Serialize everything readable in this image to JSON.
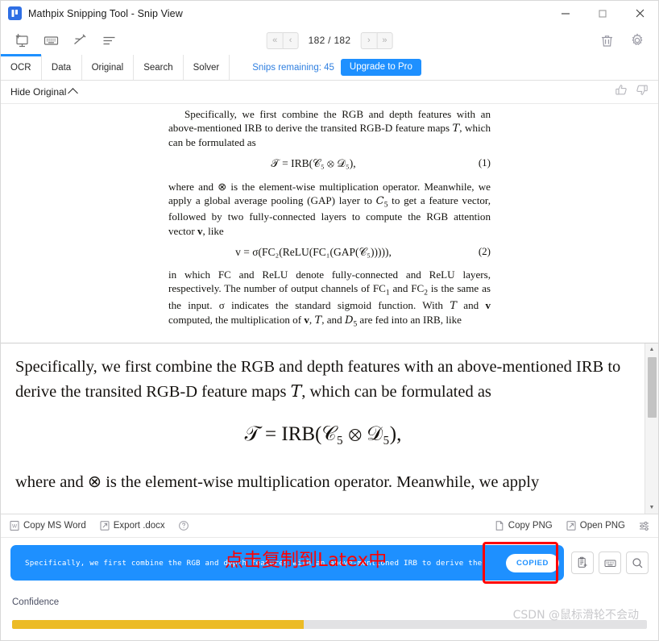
{
  "window": {
    "title": "Mathpix Snipping Tool - Snip View",
    "logo_glyph": "☰",
    "logo_color": "#2f6fe4",
    "controls": [
      {
        "name": "minimize-button",
        "glyph": "—"
      },
      {
        "name": "maximize-button",
        "glyph": "□"
      },
      {
        "name": "close-button",
        "glyph": "✕"
      }
    ]
  },
  "toolbar": {
    "icons": [
      {
        "name": "new-snip-icon",
        "label": "New Snip"
      },
      {
        "name": "keyboard-icon",
        "label": "Keyboard Shortcuts"
      },
      {
        "name": "draw-icon",
        "label": "Draw"
      },
      {
        "name": "list-icon",
        "label": "History"
      }
    ],
    "pager": {
      "first_label": "«",
      "prev_label": "‹",
      "count": "182 / 182",
      "next_label": "›",
      "last_label": "»"
    },
    "right_icons": [
      {
        "name": "trash-icon",
        "label": "Delete"
      },
      {
        "name": "gear-icon",
        "label": "Settings"
      }
    ]
  },
  "tabs": {
    "items": [
      {
        "label": "OCR",
        "active": true
      },
      {
        "label": "Data",
        "active": false
      },
      {
        "label": "Original",
        "active": false
      },
      {
        "label": "Search",
        "active": false
      },
      {
        "label": "Solver",
        "active": false
      }
    ],
    "snips_remaining": "Snips remaining: 45",
    "upgrade_label": "Upgrade to Pro",
    "accent_color": "#1e90ff"
  },
  "original_panel": {
    "hide_label": "Hide Original",
    "chevron": "chevron-up-icon",
    "thumbs_up": "thumbs-up-icon",
    "thumbs_down": "thumbs-down-icon",
    "paragraphs": [
      "Specifically, we first combine the RGB and depth features with an above-mentioned IRB to derive the transited RGB-D feature maps ᵀ, which can be formulated as",
      "where and ⊗ is the element-wise multiplication operator. Meanwhile, we apply a global average pooling (GAP) layer to 𝒞5 to get a feature vector, followed by two fully-connected layers to compute the RGB attention vector v, like",
      "in which FC and ReLU denote fully-connected and ReLU layers, respectively. The number of output channels of FC1 and FC2 is the same as the input. σ indicates the standard sigmoid function. With 𝒯 and v computed, the multiplication of v, 𝒯, and 𝒟5 are fed into an IRB, like"
    ],
    "equations": [
      {
        "body": "𝒯 = IRB(𝒞₅ ⊗ 𝒟₅),",
        "number": "(1)"
      },
      {
        "body": "v = σ(FC₂(ReLU(FC₁(GAP(𝒞₅))))),",
        "number": "(2)"
      }
    ]
  },
  "render_panel": {
    "paragraph": "Specifically, we first combine the RGB and depth features with an above-mentioned IRB to derive the transited RGB-D feature maps 𝒯, which can be formulated as",
    "equation": "𝒯 = IRB(𝒞₅ ⊗ 𝒟₅),",
    "partial_line": "where and ⊗ is the element-wise multiplication operator. Meanwhile, we apply",
    "scrollbar": {
      "up_arrow": "scroll-up-arrow-icon",
      "down_arrow": "scroll-down-arrow-icon"
    }
  },
  "action_bar": {
    "left": [
      {
        "name": "copy-ms-word-button",
        "label": "Copy MS Word",
        "icon": "word-icon"
      },
      {
        "name": "export-docx-button",
        "label": "Export .docx",
        "icon": "export-icon"
      },
      {
        "name": "help-button",
        "label": "",
        "icon": "help-icon"
      }
    ],
    "right": [
      {
        "name": "copy-png-button",
        "label": "Copy PNG",
        "icon": "file-icon"
      },
      {
        "name": "open-png-button",
        "label": "Open PNG",
        "icon": "external-link-icon"
      },
      {
        "name": "display-options-button",
        "label": "",
        "icon": "sliders-icon"
      }
    ]
  },
  "latex_result": {
    "text": "Specifically, we first combine the RGB and depth features with an above-mentioned IRB to derive the",
    "copied_label": "COPIED",
    "bar_color": "#1e90ff",
    "annotation": "点击复制到Latex中",
    "annotation_color": "#ff0000",
    "side_buttons": [
      {
        "name": "copy-clipboard-button",
        "icon": "clipboard-copy-icon"
      },
      {
        "name": "keyboard-button",
        "icon": "keyboard-icon"
      },
      {
        "name": "search-button",
        "icon": "search-icon"
      }
    ]
  },
  "confidence": {
    "label": "Confidence",
    "percent": 46,
    "fill_color": "#ecbb25",
    "track_color": "#e2e2e4"
  },
  "watermark": "CSDN @鼠标滑轮不会动"
}
